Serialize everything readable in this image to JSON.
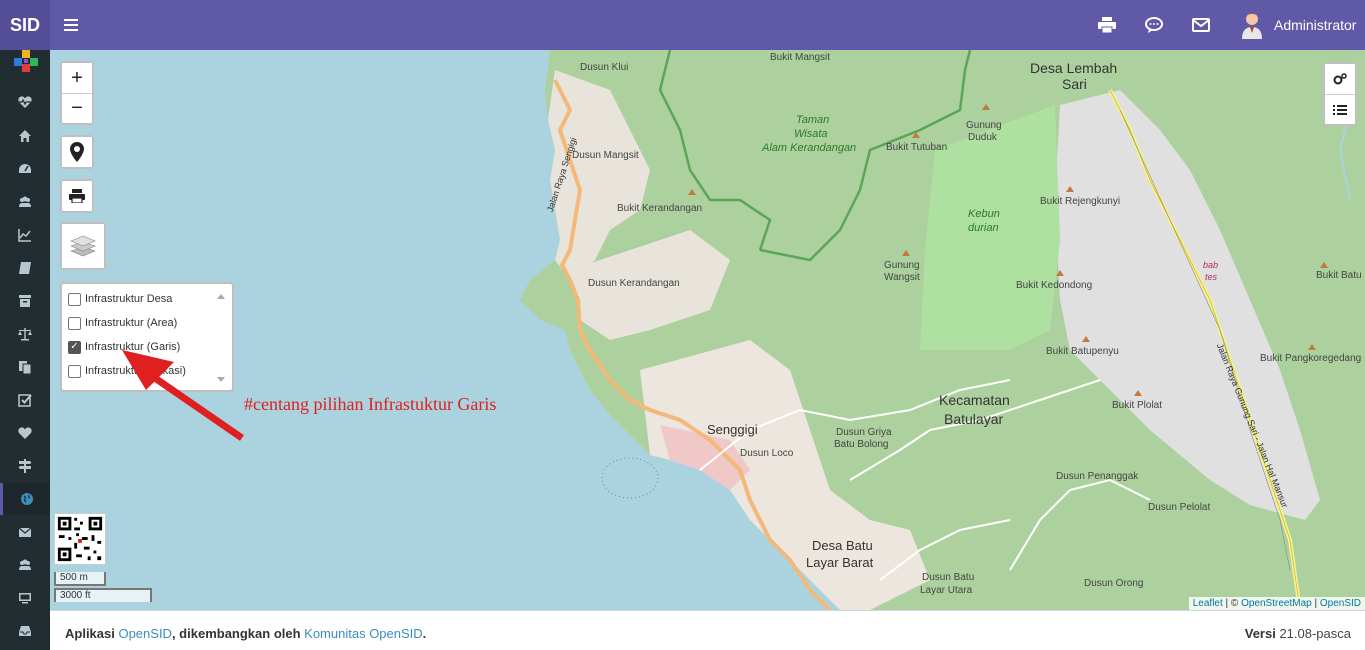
{
  "app": {
    "brand": "SID",
    "user": "Administrator"
  },
  "topbar_icons": [
    "menu-icon",
    "print-icon",
    "chat-icon",
    "mail-icon"
  ],
  "sidebar_icons": [
    "heartbeat-icon",
    "home-icon",
    "dashboard-icon",
    "users-icon",
    "chart-icon",
    "book-icon",
    "archive-icon",
    "balance-icon",
    "copy-icon",
    "checkbox-icon",
    "heart-icon",
    "signpost-icon",
    "globe-icon",
    "envelope-icon",
    "group-icon",
    "monitor-icon",
    "inbox-icon"
  ],
  "map": {
    "controls": {
      "zoom_in": "+",
      "zoom_out": "−"
    },
    "layers": [
      {
        "label": "Infrastruktur Desa",
        "checked": false
      },
      {
        "label": "Infrastruktur (Area)",
        "checked": false
      },
      {
        "label": "Infrastruktur (Garis)",
        "checked": true
      },
      {
        "label": "Infrastruktur (Lokasi)",
        "checked": false
      }
    ],
    "annotation": "#centang pilihan Infrastuktur Garis",
    "scale": {
      "metric": "500 m",
      "imperial": "3000 ft"
    },
    "attribution": {
      "leaflet": "Leaflet",
      "sep1": " | © ",
      "osm": "OpenStreetMap",
      "sep2": " | ",
      "opensid": "OpenSID"
    },
    "labels": {
      "dusun_klui": "Dusun Klui",
      "bukit_mangsit": "Bukit Mangsit",
      "desa_lembah_sari_1": "Desa Lembah",
      "desa_lembah_sari_2": "Sari",
      "taman_1": "Taman",
      "taman_2": "Wisata",
      "taman_3": "Alam Kerandangan",
      "gunung_duduk_1": "Gunung",
      "gunung_duduk_2": "Duduk",
      "bukit_tutuban": "Bukit Tutuban",
      "dusun_mangsit": "Dusun Mangsit",
      "bukit_kerandangan": "Bukit Kerandangan",
      "kebun_1": "Kebun",
      "kebun_2": "durian",
      "bukit_rejengkunyi": "Bukit Rejengkunyi",
      "jalan_sengigi": "Jalan Raya Sengigi",
      "gunung_wangsit_1": "Gunung",
      "gunung_wangsit_2": "Wangsit",
      "bukit_kedondong": "Bukit Kedondong",
      "babtes_1": "bab",
      "babtes_2": "tes",
      "bukit_batu": "Bukit Batu",
      "dusun_kerandangan": "Dusun Kerandangan",
      "bukit_batupenyu": "Bukit Batupenyu",
      "bukit_pangkoregedang": "Bukit Pangkoregedang",
      "kecamatan_1": "Kecamatan",
      "kecamatan_2": "Batulayar",
      "bukit_plolat": "Bukit Plolat",
      "senggigi": "Senggigi",
      "dusun_griya_1": "Dusun Griya",
      "dusun_griya_2": "Batu Bolong",
      "dusun_loco": "Dusun Loco",
      "dusun_penanggak": "Dusun Penanggak",
      "dusun_pelolat": "Dusun Pelolat",
      "desa_batu_layar_1": "Desa Batu",
      "desa_batu_layar_2": "Layar Barat",
      "dusun_batu_layar_1": "Dusun Batu",
      "dusun_batu_layar_2": "Layar Utara",
      "dusun_orong": "Dusun Orong",
      "jalan_gunung_sari": "Jalan Raya Gunung Sari - Jalan Hal Mansur"
    }
  },
  "footer": {
    "prefix": "Aplikasi ",
    "opensid": "OpenSID",
    "middle": ", dikembangkan oleh ",
    "komunitas": "Komunitas OpenSID",
    "suffix": ".",
    "versi_label": "Versi",
    "versi_value": " 21.08-pasca"
  }
}
